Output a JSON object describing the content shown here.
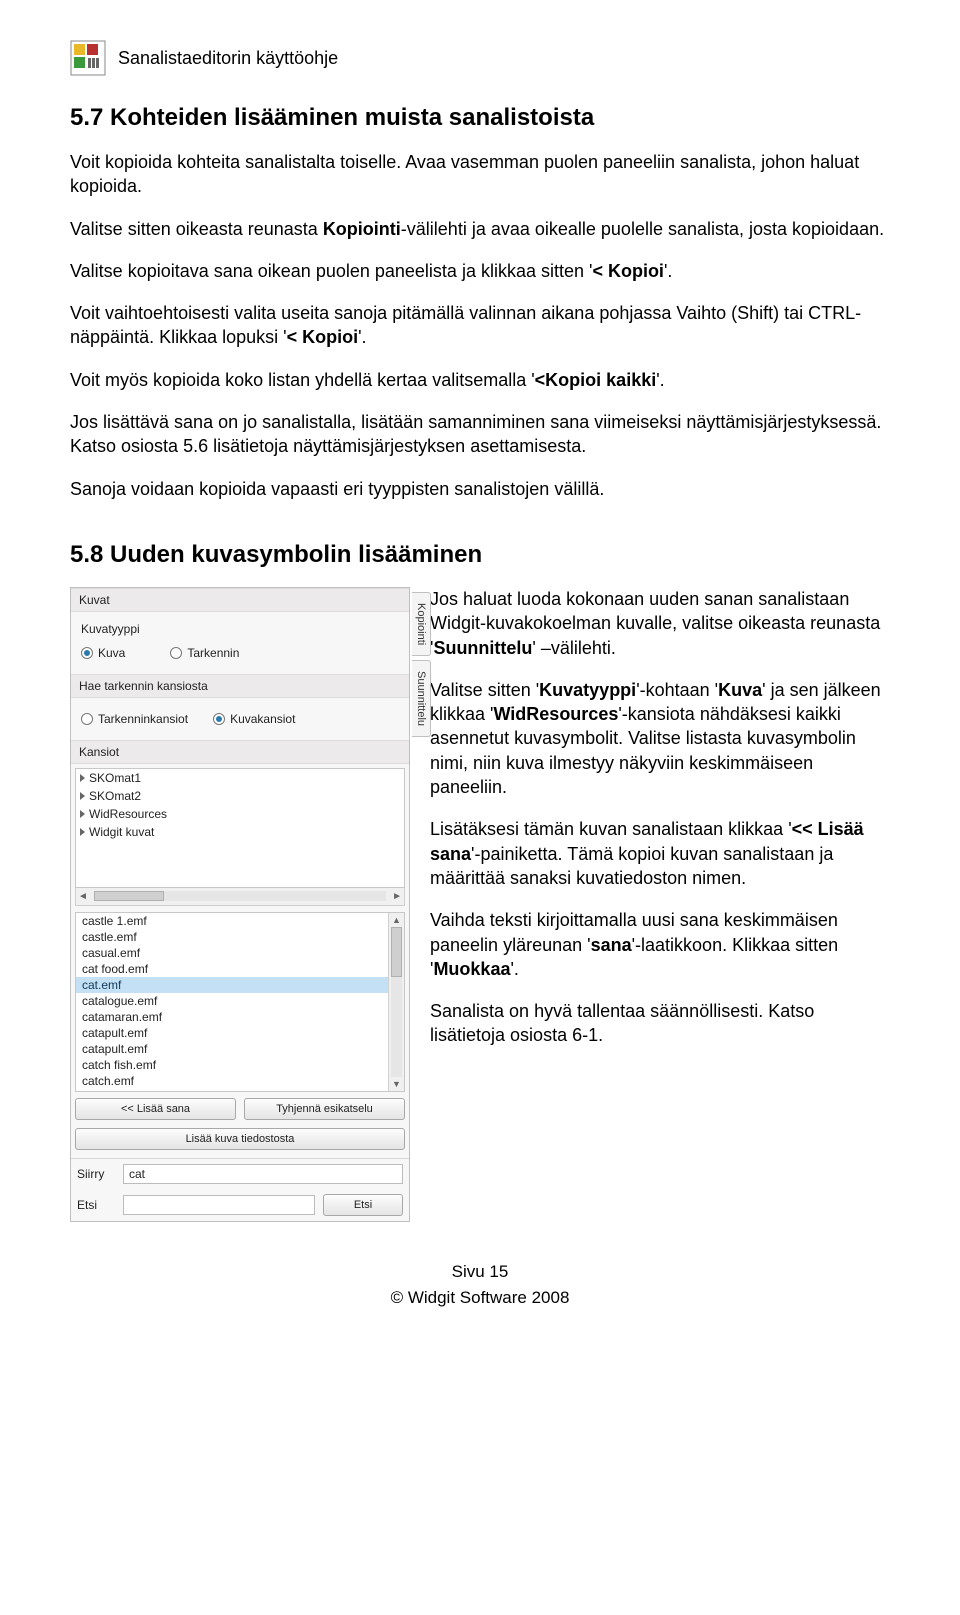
{
  "header": {
    "title": "Sanalistaeditorin käyttöohje"
  },
  "section57": {
    "heading": "5.7 Kohteiden lisääminen muista sanalistoista",
    "p1": "Voit kopioida kohteita sanalistalta toiselle. Avaa vasemman puolen paneeliin sanalista, johon haluat kopioida.",
    "p2a": "Valitse sitten oikeasta reunasta ",
    "p2b": "Kopiointi",
    "p2c": "-välilehti ja avaa oikealle puolelle sanalista, josta kopioidaan.",
    "p3a": "Valitse kopioitava sana oikean puolen paneelista ja klikkaa sitten '",
    "p3b": "< Kopioi",
    "p3c": "'.",
    "p4a": "Voit vaihtoehtoisesti valita useita sanoja pitämällä valinnan aikana pohjassa Vaihto (Shift) tai CTRL-näppäintä. Klikkaa lopuksi '",
    "p4b": "< Kopioi",
    "p4c": "'.",
    "p5a": "Voit myös kopioida koko listan yhdellä kertaa valitsemalla '",
    "p5b": "<Kopioi kaikki",
    "p5c": "'.",
    "p6": "Jos lisättävä sana on jo sanalistalla, lisätään samanniminen sana viimeiseksi näyttämisjärjestyksessä. Katso osiosta 5.6 lisätietoja näyttämisjärjestyksen asettamisesta.",
    "p7": "Sanoja voidaan kopioida vapaasti eri tyyppisten sanalistojen välillä."
  },
  "section58": {
    "heading": "5.8 Uuden kuvasymbolin lisääminen",
    "p1a": "Jos haluat luoda kokonaan uuden sanan sanalistaan Widgit-kuvakokoelman kuvalle, valitse oikeasta reunasta '",
    "p1b": "Suunnittelu",
    "p1c": "' –välilehti.",
    "p2a": "Valitse sitten '",
    "p2b": "Kuvatyyppi",
    "p2c": "'-kohtaan '",
    "p2d": "Kuva",
    "p2e": "' ja sen jälkeen klikkaa '",
    "p2f": "WidResources",
    "p2g": "'-kansiota nähdäksesi kaikki asennetut kuvasymbolit. Valitse listasta kuvasymbolin nimi, niin kuva ilmestyy näkyviin keskimmäiseen paneeliin.",
    "p3a": "Lisätäksesi tämän kuvan sanalistaan klikkaa '",
    "p3b": "<< Lisää sana",
    "p3c": "'-painiketta. Tämä kopioi kuvan sanalistaan ja määrittää sanaksi kuvatiedoston nimen.",
    "p4a": "Vaihda teksti kirjoittamalla uusi sana keskimmäisen paneelin yläreunan '",
    "p4b": "sana",
    "p4c": "'-laatikkoon. Klikkaa sitten '",
    "p4d": "Muokkaa",
    "p4e": "'.",
    "p5": "Sanalista on hyvä tallentaa säännöllisesti. Katso lisätietoja osiosta 6-1."
  },
  "panel": {
    "tab_kopiointi": "Kopiointi",
    "tab_suunnittelu": "Suunnittelu",
    "kuvat_title": "Kuvat",
    "kuvatyyppi_label": "Kuvatyyppi",
    "radio_kuva": "Kuva",
    "radio_tarkennin": "Tarkennin",
    "hae_title": "Hae tarkennin kansiosta",
    "radio_tarkenninkansiot": "Tarkenninkansiot",
    "radio_kuvakansiot": "Kuvakansiot",
    "kansiot_title": "Kansiot",
    "folders": [
      "SKOmat1",
      "SKOmat2",
      "WidResources",
      "Widgit kuvat"
    ],
    "files": [
      "castle 1.emf",
      "castle.emf",
      "casual.emf",
      "cat food.emf",
      "cat.emf",
      "catalogue.emf",
      "catamaran.emf",
      "catapult.emf",
      "catapult.emf",
      "catch fish.emf",
      "catch.emf"
    ],
    "selected_file_index": 4,
    "btn_lisaa": "<< Lisää sana",
    "btn_tyhjenna": "Tyhjennä esikatselu",
    "btn_lisaa_tiedosto": "Lisää kuva tiedostosta",
    "siirry_label": "Siirry",
    "siirry_value": "cat",
    "etsi_label": "Etsi",
    "etsi_value": "",
    "etsi_btn": "Etsi"
  },
  "footer": {
    "page": "Sivu 15",
    "copyright": "© Widgit Software 2008"
  }
}
